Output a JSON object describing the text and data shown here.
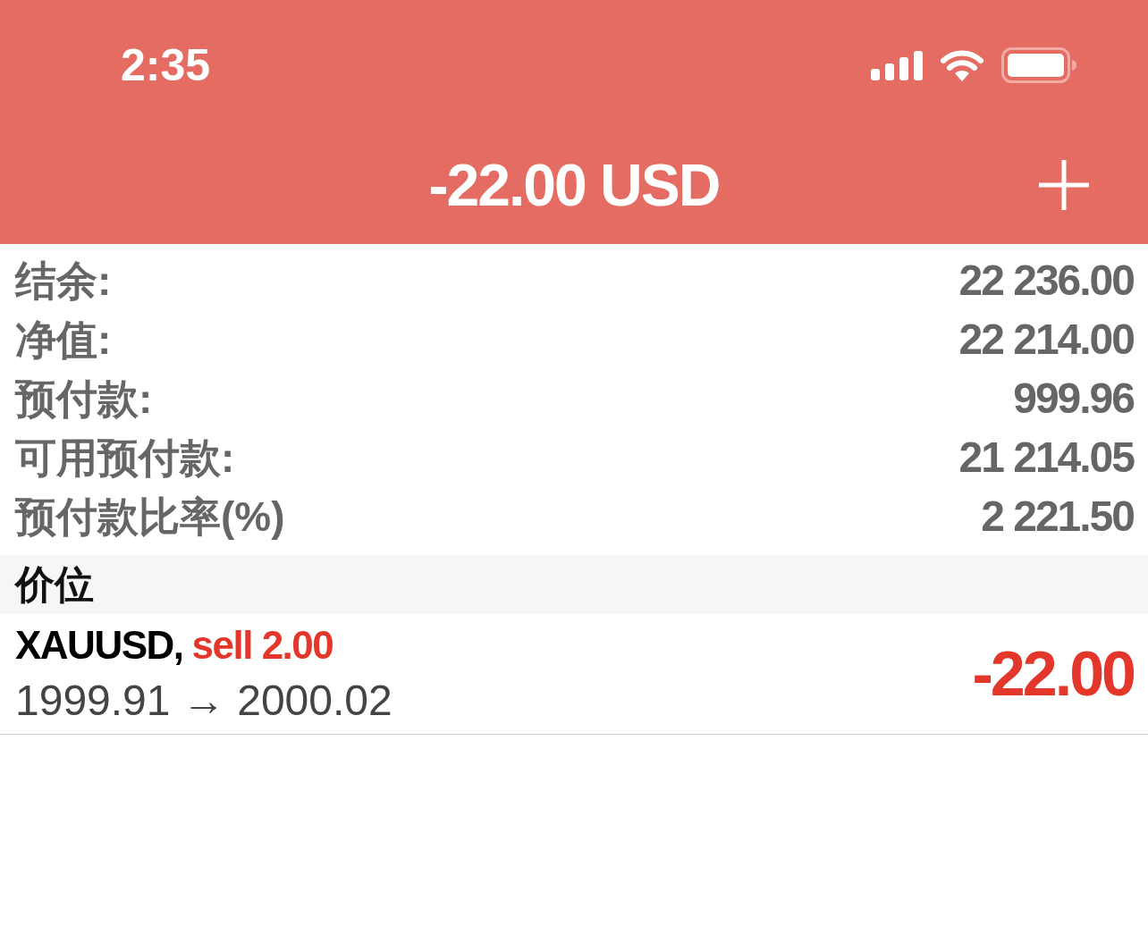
{
  "status_bar": {
    "time": "2:35"
  },
  "header": {
    "title": "-22.00 USD"
  },
  "account": [
    {
      "label": "结余:",
      "value": "22 236.00"
    },
    {
      "label": "净值:",
      "value": "22 214.00"
    },
    {
      "label": "预付款:",
      "value": "999.96"
    },
    {
      "label": "可用预付款:",
      "value": "21 214.05"
    },
    {
      "label": "预付款比率(%)",
      "value": "2 221.50"
    }
  ],
  "positions_section": {
    "title": "价位",
    "positions": [
      {
        "symbol": "XAUUSD,",
        "order": "sell 2.00",
        "prices": "1999.91 → 2000.02",
        "profit": "-22.00"
      }
    ]
  }
}
